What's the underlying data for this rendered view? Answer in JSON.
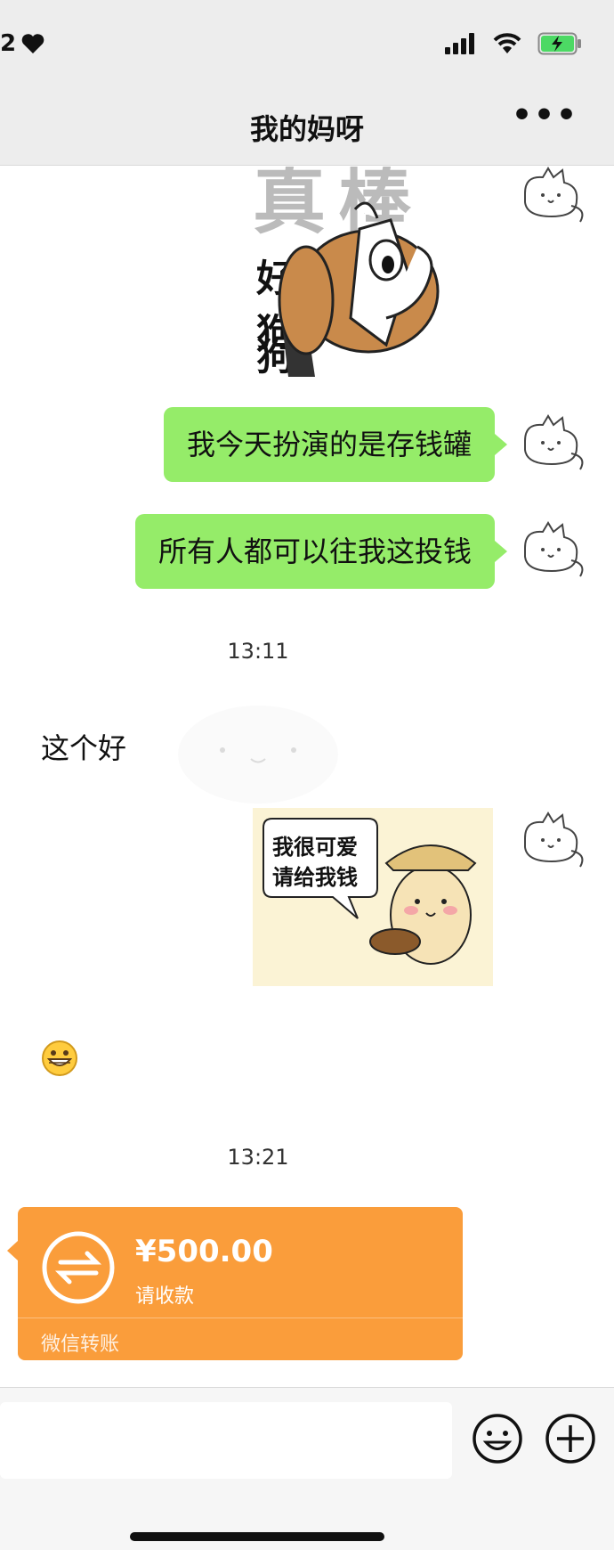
{
  "status_bar": {
    "time_fragment": "2",
    "heart_icon": "heart-icon",
    "signal_icon": "cell-signal-icon",
    "wifi_icon": "wifi-icon",
    "battery_icon": "battery-charging-icon"
  },
  "header": {
    "title": "我的妈呀",
    "more_icon": "more-dots-icon",
    "more_label": "•••"
  },
  "messages": {
    "sticker1_lines": [
      "真棒",
      "好狗",
      "狗狗"
    ],
    "msg1": "我今天扮演的是存钱罐",
    "msg2": "所有人都可以往我这投钱",
    "time1": "13:11",
    "msg3": "这个好",
    "sticker2_line1": "我很可爱",
    "sticker2_line2": "请给我钱",
    "emoji_icon": "grin-emoji-icon",
    "time2": "13:21"
  },
  "transfer": {
    "amount": "¥500.00",
    "status": "请收款",
    "footer": "微信转账",
    "icon": "transfer-arrows-icon"
  },
  "input_bar": {
    "emoji_icon": "smiley-icon",
    "plus_icon": "plus-icon"
  },
  "colors": {
    "accent_green": "#95ec69",
    "transfer_orange": "#fa9d3b",
    "header_bg": "#ededed"
  }
}
